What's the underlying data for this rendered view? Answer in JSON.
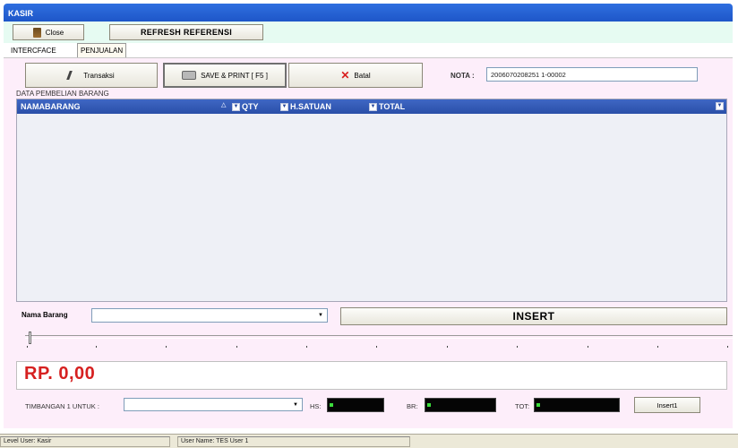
{
  "window": {
    "title": "KASIR"
  },
  "toolbar": {
    "close_label": "Close",
    "refresh_label": "REFRESH REFERENSI"
  },
  "tabs": [
    {
      "label": "INTERCFACE"
    },
    {
      "label": "PENJUALAN"
    }
  ],
  "actions": {
    "transaksi_label": "Transaksi",
    "save_label": "SAVE & PRINT [ F5 ]",
    "batal_label": "Batal"
  },
  "nota": {
    "label": "NOTA :",
    "value": "2006070208251 1-00002"
  },
  "grid": {
    "section_label": "DATA PEMBELIAN BARANG",
    "columns": [
      "NAMABARANG",
      "QTY",
      "H.SATUAN",
      "TOTAL"
    ],
    "rows": []
  },
  "entry": {
    "nama_label": "Nama Barang",
    "nama_value": "",
    "insert_label": "INSERT"
  },
  "total": {
    "display": "RP. 0,00"
  },
  "timbangan": {
    "label": "TIMBANGAN 1 UNTUK :",
    "hs_label": "HS:",
    "br_label": "BR:",
    "tot_label": "TOT:",
    "insert1_label": "Insert1"
  },
  "status": {
    "level_user": "Level User: Kasir",
    "user_name": "User Name: TES User 1"
  },
  "colors": {
    "accent": "#2a4fa8",
    "total_text": "#d62020",
    "title_bar": "#1e56c8"
  }
}
